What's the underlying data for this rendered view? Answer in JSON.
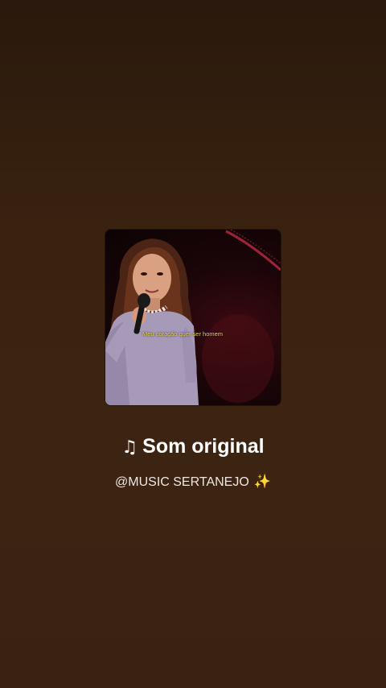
{
  "sound": {
    "title": "Som original",
    "author": "@MUSIC SERTANEJO",
    "title_icon": "music-note-icon",
    "author_icon": "sparkle-icon"
  },
  "cover": {
    "caption": "Meu coração quer ser homem",
    "overlay_icon": "equalizer-bars-icon"
  },
  "colors": {
    "background_top": "#2a190c",
    "background_bottom": "#3a2112",
    "title_text": "#ffffff",
    "author_text": "#eee6e0",
    "caption_text": "#e9d44a",
    "sparkle": "#8a4fd6"
  }
}
